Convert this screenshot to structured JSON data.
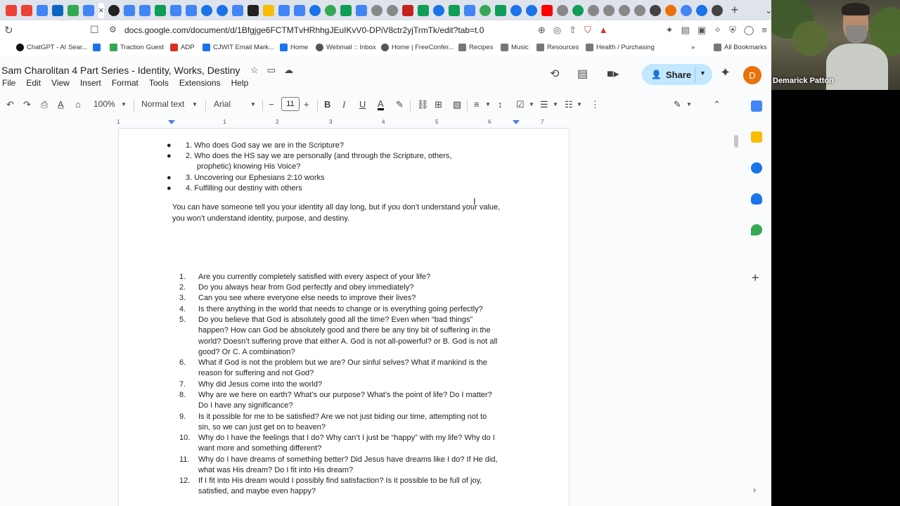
{
  "browser": {
    "url": "docs.google.com/document/d/1Bfgjge6FCTMTvHRhhgJEuIKvV0-DPiV8ctr2yjTrmTk/edit?tab=t.0",
    "tab_close": "×",
    "new_tab": "+",
    "bookmarks": [
      {
        "label": "ChatGPT - AI Sear...",
        "color": "#111"
      },
      {
        "label": "Traction Guest",
        "color": "#34a853"
      },
      {
        "label": "ADP",
        "color": "#d93025"
      },
      {
        "label": "CJWIT Email Mark...",
        "color": "#1a73e8"
      },
      {
        "label": "Home",
        "color": "#1a73e8"
      },
      {
        "label": "Webmail :: Inbox",
        "color": "#555"
      },
      {
        "label": "Home | FreeConfer...",
        "color": "#555"
      },
      {
        "label": "Recipes",
        "color": "#777"
      },
      {
        "label": "Music",
        "color": "#777"
      },
      {
        "label": "Resources",
        "color": "#777"
      },
      {
        "label": "Health / Purchasing",
        "color": "#777"
      },
      {
        "label": "All Bookmarks",
        "color": "#777"
      }
    ],
    "bookmarks_overflow": "»"
  },
  "docs": {
    "title": "Sam Charolitan 4 Part Series - Identity, Works, Destiny",
    "menu": [
      "File",
      "Edit",
      "View",
      "Insert",
      "Format",
      "Tools",
      "Extensions",
      "Help"
    ],
    "share_label": "Share",
    "avatar_letter": "D",
    "toolbar": {
      "zoom": "100%",
      "style": "Normal text",
      "font": "Arial",
      "font_size": "11"
    },
    "ruler_numbers": [
      "1",
      "1",
      "2",
      "3",
      "4",
      "5",
      "6",
      "7"
    ]
  },
  "content": {
    "bullets": [
      {
        "marker": "●",
        "lines": [
          "1.  Who does God say we are in the Scripture?"
        ]
      },
      {
        "marker": "●",
        "lines": [
          "2.  Who does the HS say we are personally (and through the Scripture, others,",
          "prophetic) knowing His Voice?"
        ]
      },
      {
        "marker": "●",
        "lines": [
          "3.  Uncovering our Ephesians 2:10 works"
        ]
      },
      {
        "marker": "●",
        "lines": [
          "4.  Fulfilling our destiny with others"
        ]
      }
    ],
    "paragraph": [
      "You can have someone tell you your identity all day long, but if you don’t understand your value,",
      "you won’t understand identity, purpose, and destiny."
    ],
    "questions": [
      {
        "num": "1.",
        "lines": [
          "Are you currently completely satisfied with every aspect of your life?"
        ]
      },
      {
        "num": "2.",
        "lines": [
          "Do you always hear from God perfectly and obey immediately?"
        ]
      },
      {
        "num": "3.",
        "lines": [
          "Can you see where everyone else needs to improve their lives?"
        ]
      },
      {
        "num": "4.",
        "lines": [
          "Is there anything in the world that needs to change or is everything going perfectly?"
        ]
      },
      {
        "num": "5.",
        "lines": [
          "Do you believe that God is absolutely good all the time?  Even when “bad things”",
          "happen?  How can God be absolutely good and there be any tiny bit of suffering in the",
          "world?  Doesn’t suffering prove that either A. God is not all-powerful? or B. God is not all",
          "good? Or C. A combination?"
        ]
      },
      {
        "num": "6.",
        "lines": [
          "What if God is not the problem but we are? Our sinful selves?  What if mankind is the",
          "reason for suffering and not God?"
        ]
      },
      {
        "num": "7.",
        "lines": [
          "Why did Jesus come into the world?"
        ]
      },
      {
        "num": "8.",
        "lines": [
          "Why are we here on earth?  What’s our purpose?  What’s the point of life?  Do I matter?",
          "Do I  have any significance?"
        ]
      },
      {
        "num": "9.",
        "lines": [
          "Is it possible for me to be satisfied?  Are we not just biding our time, attempting not to",
          "sin, so we can just get on to heaven?"
        ]
      },
      {
        "num": "10.",
        "lines": [
          "Why do I have the feelings that I do?  Why can’t I just be “happy” with my life?  Why do I",
          "want more and something different?"
        ]
      },
      {
        "num": "11.",
        "lines": [
          "Why do I have dreams of something better?  Did Jesus have dreams like I do?  If He did,",
          "what was His dream?  Do I fit into His dream?"
        ]
      },
      {
        "num": "12.",
        "lines": [
          "If I fit into His dream would I possibly find satisfaction?  Is it possible to be full of joy,",
          "satisfied, and maybe even happy?"
        ]
      }
    ]
  },
  "video": {
    "participant_name": "Demarick Patton"
  }
}
